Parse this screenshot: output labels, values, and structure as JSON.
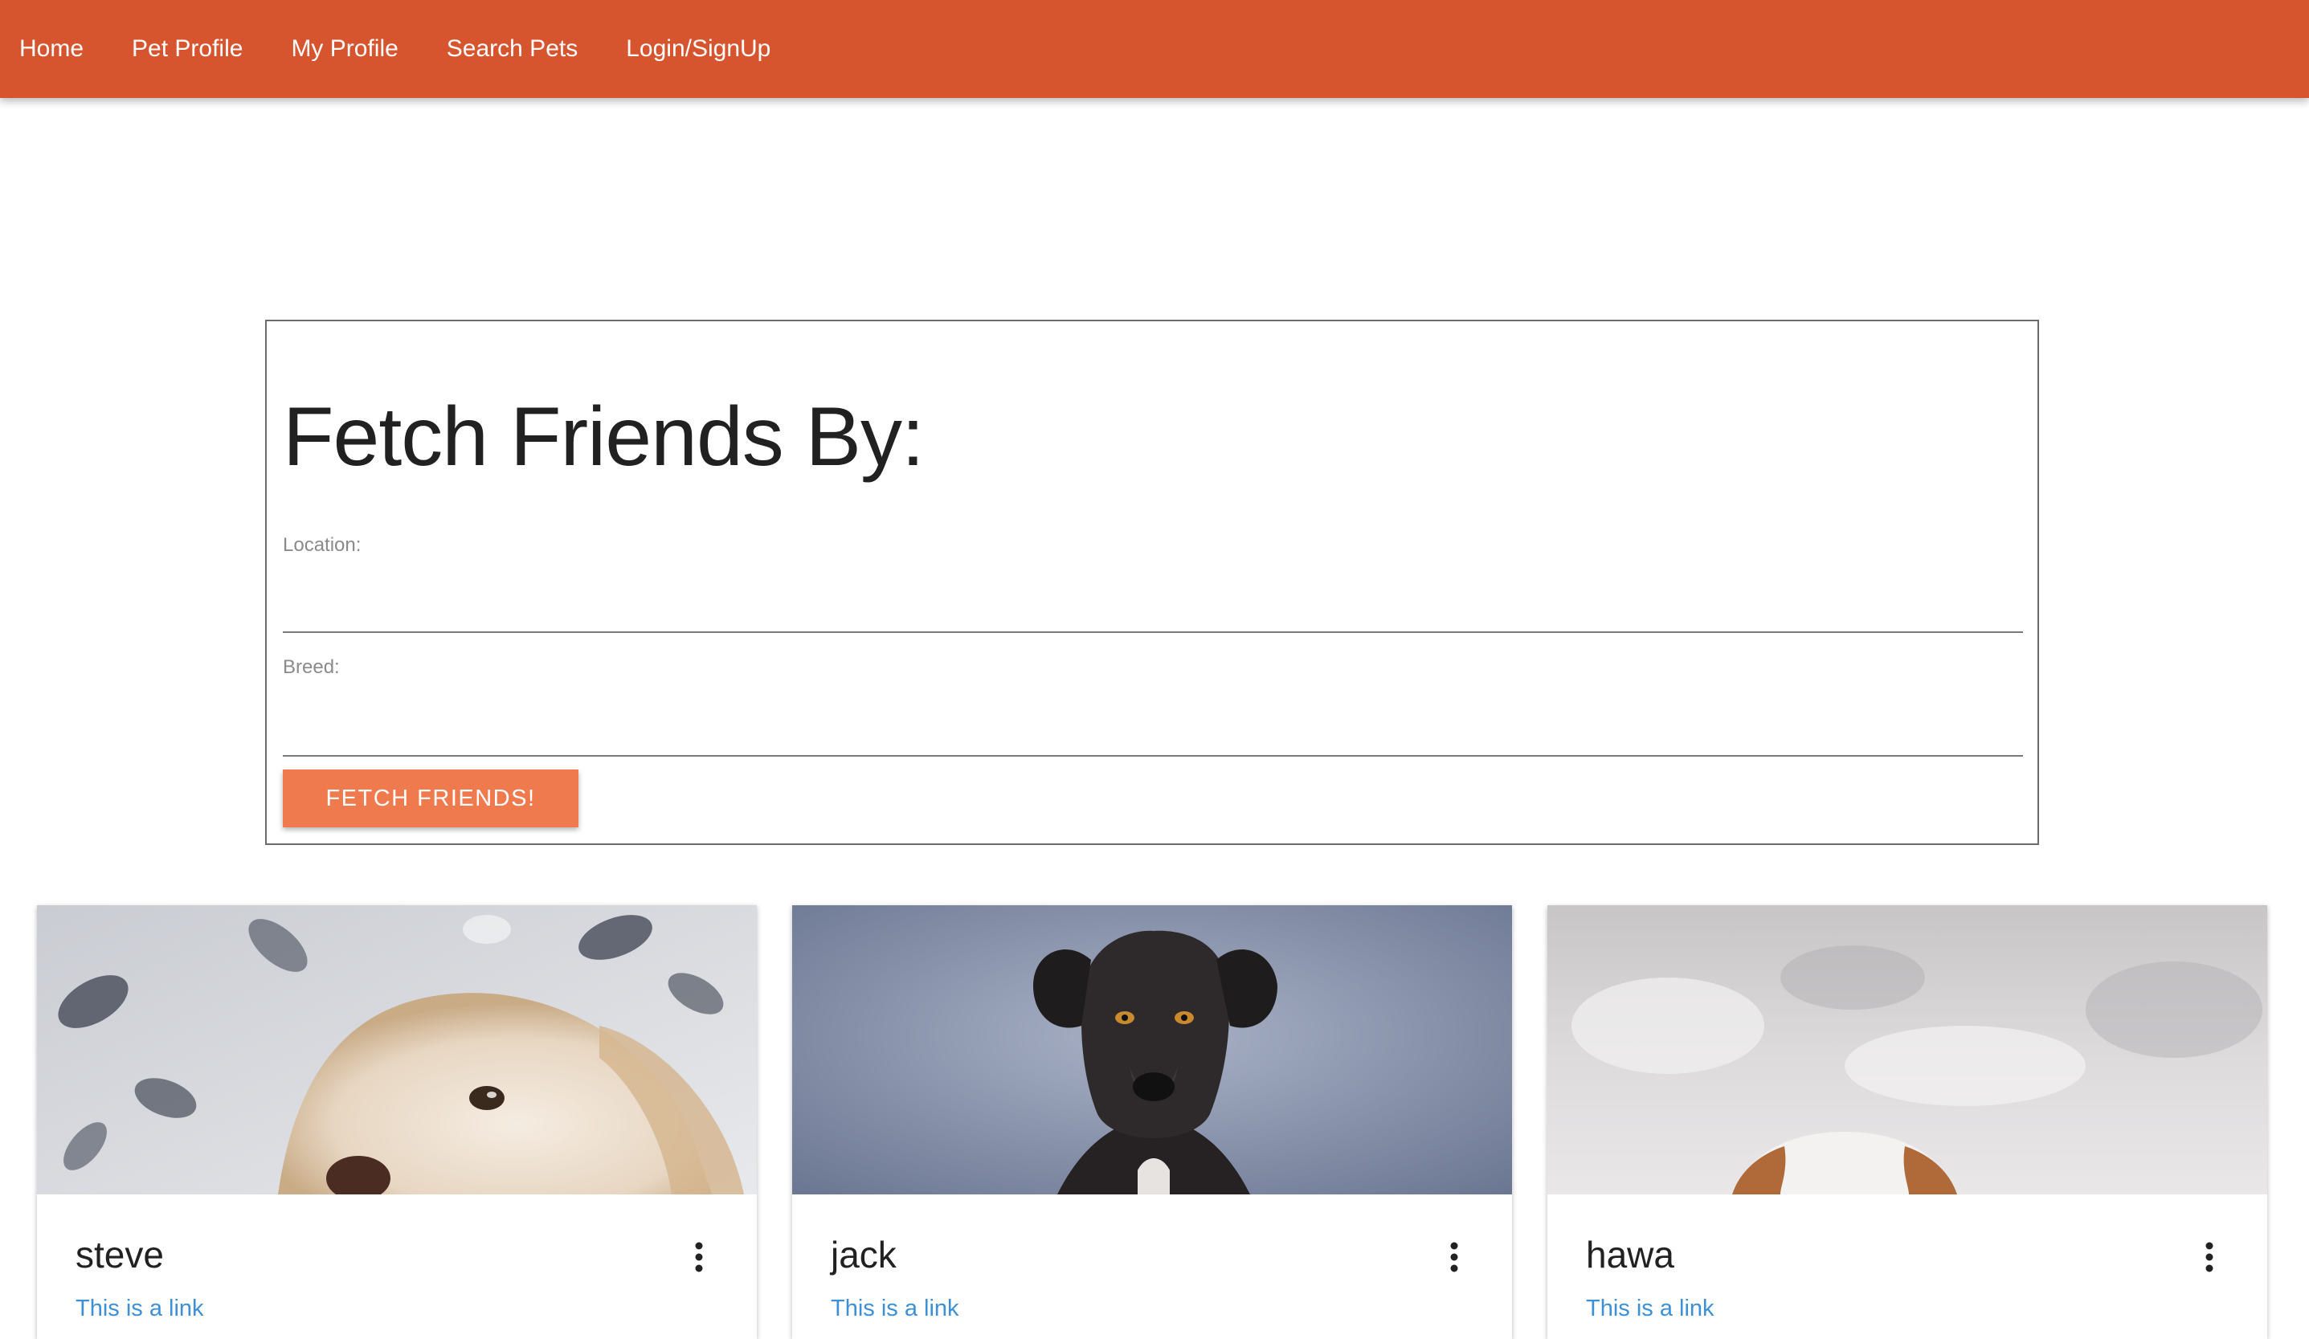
{
  "nav": {
    "items": [
      {
        "label": "Home"
      },
      {
        "label": "Pet Profile"
      },
      {
        "label": "My Profile"
      },
      {
        "label": "Search Pets"
      },
      {
        "label": "Login/SignUp"
      }
    ],
    "color": "#d6552f"
  },
  "form": {
    "title": "Fetch Friends By:",
    "location_label": "Location:",
    "location_value": "",
    "breed_label": "Breed:",
    "breed_value": "",
    "button_label": "FETCH FRIENDS!",
    "button_color": "#ee7a4e"
  },
  "cards": [
    {
      "name": "steve",
      "link": "This is a link",
      "menu_icon": "more-vert-icon"
    },
    {
      "name": "jack",
      "link": "This is a link",
      "menu_icon": "more-vert-icon"
    },
    {
      "name": "hawa",
      "link": "This is a link",
      "menu_icon": "more-vert-icon"
    }
  ]
}
